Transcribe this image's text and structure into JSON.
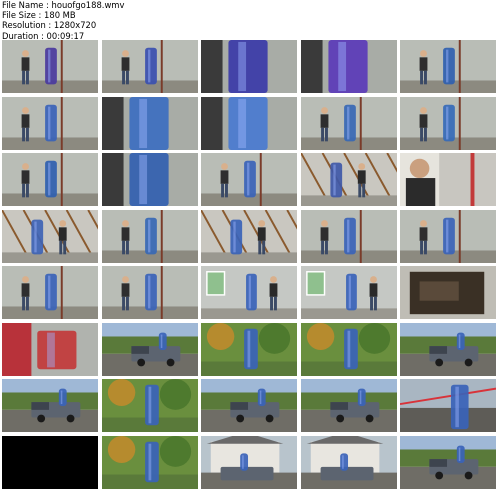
{
  "file_info": {
    "name_label": "File Name",
    "name_value": "houofgo188.wmv",
    "size_label": "File Size",
    "size_value": "180 MB",
    "resolution_label": "Resolution",
    "resolution_value": "1280x720",
    "duration_label": "Duration",
    "duration_value": "00:09:17"
  },
  "thumbnails": [
    {
      "scene": "barn-interior",
      "accent": "#4a3a9e"
    },
    {
      "scene": "barn-interior",
      "accent": "#3a4fb0"
    },
    {
      "scene": "closeup-wrap",
      "accent": "#3b3aa8"
    },
    {
      "scene": "closeup-wrap",
      "accent": "#5b3ab8"
    },
    {
      "scene": "barn-interior",
      "accent": "#2f5fb0"
    },
    {
      "scene": "barn-interior",
      "accent": "#3a63b8"
    },
    {
      "scene": "closeup-wrap",
      "accent": "#3d6ec0"
    },
    {
      "scene": "closeup-wrap",
      "accent": "#4a7ad0"
    },
    {
      "scene": "barn-interior",
      "accent": "#3768b5"
    },
    {
      "scene": "barn-interior",
      "accent": "#356ab8"
    },
    {
      "scene": "barn-interior",
      "accent": "#2f5fb0"
    },
    {
      "scene": "closeup-wrap",
      "accent": "#335fb0"
    },
    {
      "scene": "barn-interior",
      "accent": "#3a63b8"
    },
    {
      "scene": "rafters",
      "accent": "#3f58a8"
    },
    {
      "scene": "person-closeup",
      "accent": "#c23a3a"
    },
    {
      "scene": "rafters",
      "accent": "#3e63b5"
    },
    {
      "scene": "barn-interior",
      "accent": "#3768b5"
    },
    {
      "scene": "rafters",
      "accent": "#3a63b8"
    },
    {
      "scene": "barn-interior",
      "accent": "#3a63b8"
    },
    {
      "scene": "barn-interior",
      "accent": "#3a63b8"
    },
    {
      "scene": "barn-interior",
      "accent": "#3a63b8"
    },
    {
      "scene": "barn-interior",
      "accent": "#3a63b8"
    },
    {
      "scene": "window-room",
      "accent": "#3a63b8"
    },
    {
      "scene": "window-room",
      "accent": "#3a63b8"
    },
    {
      "scene": "open-door",
      "accent": "#6b5a3a"
    },
    {
      "scene": "red-closeup",
      "accent": "#c23a3a"
    },
    {
      "scene": "outdoor-truck",
      "accent": "#3a63b8"
    },
    {
      "scene": "outdoor-trees",
      "accent": "#3a63b8"
    },
    {
      "scene": "outdoor-trees",
      "accent": "#3a63b8"
    },
    {
      "scene": "outdoor-truck",
      "accent": "#3a63b8"
    },
    {
      "scene": "outdoor-truck",
      "accent": "#3a63b8"
    },
    {
      "scene": "outdoor-trees",
      "accent": "#3a63b8"
    },
    {
      "scene": "outdoor-truck",
      "accent": "#3a63b8"
    },
    {
      "scene": "outdoor-truck",
      "accent": "#3a63b8"
    },
    {
      "scene": "outdoor-wide",
      "accent": "#3a63b8"
    },
    {
      "scene": "black",
      "accent": "#000000"
    },
    {
      "scene": "outdoor-trees",
      "accent": "#3a63b8"
    },
    {
      "scene": "outdoor-house",
      "accent": "#3a63b8"
    },
    {
      "scene": "outdoor-house",
      "accent": "#3a63b8"
    },
    {
      "scene": "outdoor-truck",
      "accent": "#3a63b8"
    }
  ]
}
